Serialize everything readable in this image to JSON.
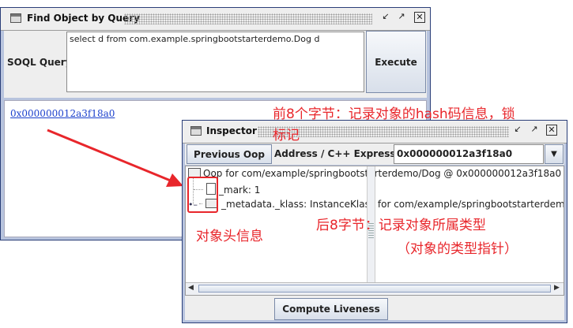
{
  "query_window": {
    "title": "Find Object by Query",
    "soql_label": "SOQL Query :",
    "query_text": "select  d from com.example.springbootstarterdemo.Dog d",
    "execute_label": "Execute",
    "result_link": "0x000000012a3f18a0"
  },
  "inspector": {
    "title": "Inspector",
    "previous_label": "Previous Oop",
    "address_label": "Address / C++ Expression:",
    "address_value": "0x000000012a3f18a0",
    "tree": {
      "root": "Oop for com/example/springbootstarterdemo/Dog @ 0x000000012a3f18a0",
      "mark": "_mark: 1",
      "klass": "_metadata._klass: InstanceKlass for com/example/springbootstarterdemo/Dog"
    },
    "compute_label": "Compute Liveness"
  },
  "annotations": {
    "top_line1": "前8个字节：记录对象的hash码信息，锁",
    "top_line2": "标记",
    "header_label": "对象头信息",
    "klass_line1": "后8字节：记录对象所属类型",
    "klass_line2": "（对象的类型指针）"
  },
  "colors": {
    "annotation": "#e8262b",
    "link": "#1a3fcc",
    "frame": "#2a3e78"
  }
}
